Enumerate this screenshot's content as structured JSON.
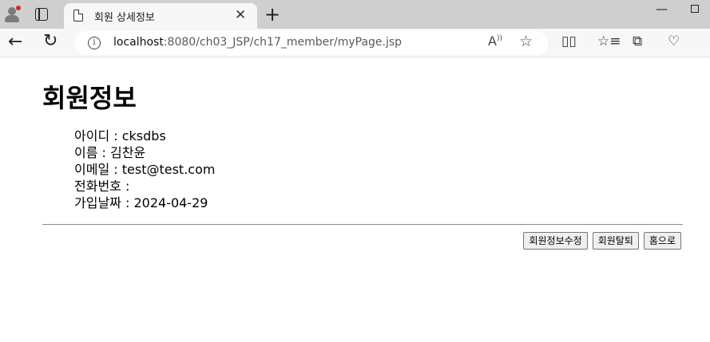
{
  "browser": {
    "tab_title": "회원 상세정보",
    "tab_close": "✕",
    "new_tab": "+",
    "url_host": "localhost",
    "url_path": ":8080/ch03_JSP/ch17_member/myPage.jsp"
  },
  "page": {
    "title": "회원정보",
    "fields": [
      {
        "label": "아이디",
        "value": "cksdbs"
      },
      {
        "label": "이름",
        "value": "김찬윤"
      },
      {
        "label": "이메일",
        "value": "test@test.com"
      },
      {
        "label": "전화번호",
        "value": ""
      },
      {
        "label": "가입날짜",
        "value": "2024-04-29"
      }
    ],
    "buttons": {
      "edit": "회원정보수정",
      "withdraw": "회원탈퇴",
      "home": "홈으로"
    }
  },
  "icons": {
    "profile": "profile-icon",
    "tab_actions": "tab-actions-icon",
    "back": "back-arrow-icon",
    "reload": "reload-icon",
    "site_info": "info-icon",
    "read_aloud": "read-aloud-icon",
    "favorite": "star-icon",
    "split_screen": "split-screen-icon",
    "favorites_list": "favorites-icon",
    "collections": "collections-icon",
    "heart_health": "browser-essentials-icon"
  }
}
